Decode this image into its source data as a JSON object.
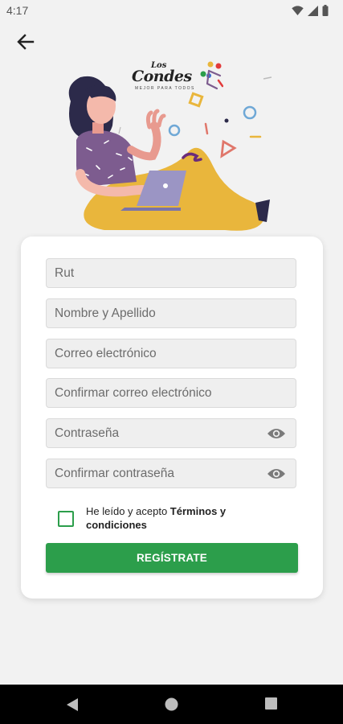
{
  "status": {
    "time": "4:17",
    "icons": [
      "wifi-icon",
      "signal-icon",
      "battery-icon"
    ]
  },
  "header": {
    "back_icon": "arrow-left-icon"
  },
  "logo": {
    "line1": "Los",
    "line2": "Condes",
    "tagline": "MEJOR PARA TODOS"
  },
  "form": {
    "rut_placeholder": "Rut",
    "name_placeholder": "Nombre y Apellido",
    "email_placeholder": "Correo electrónico",
    "email_confirm_placeholder": "Confirmar correo electrónico",
    "password_placeholder": "Contraseña",
    "password_confirm_placeholder": "Confirmar contraseña",
    "terms_prefix": "He leído y acepto ",
    "terms_link": "Términos y condiciones",
    "checkbox_checked": false,
    "register_label": "REGÍSTRATE"
  },
  "colors": {
    "accent": "#2c9e4b",
    "background": "#f2f2f2",
    "card": "#ffffff"
  },
  "nav": {
    "back_icon": "nav-back-icon",
    "home_icon": "nav-home-icon",
    "recents_icon": "nav-recents-icon"
  }
}
